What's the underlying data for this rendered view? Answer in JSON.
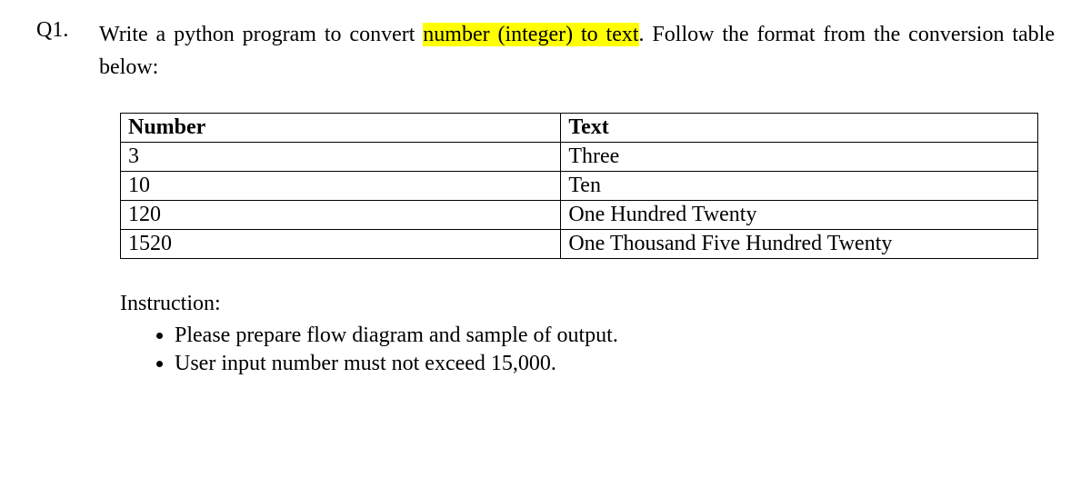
{
  "question": {
    "label": "Q1.",
    "text_before": "Write a python program to convert ",
    "highlighted": "number (integer) to text",
    "text_after": ". Follow the format from the conversion table below:"
  },
  "table": {
    "headers": {
      "number": "Number",
      "text": "Text"
    },
    "rows": [
      {
        "number": "3",
        "text": "Three"
      },
      {
        "number": "10",
        "text": "Ten"
      },
      {
        "number": "120",
        "text": "One Hundred Twenty"
      },
      {
        "number": "1520",
        "text": "One Thousand Five Hundred Twenty"
      }
    ]
  },
  "instruction": {
    "heading": "Instruction:",
    "items": [
      "Please prepare flow diagram and sample of output.",
      "User input number must not exceed 15,000."
    ]
  }
}
